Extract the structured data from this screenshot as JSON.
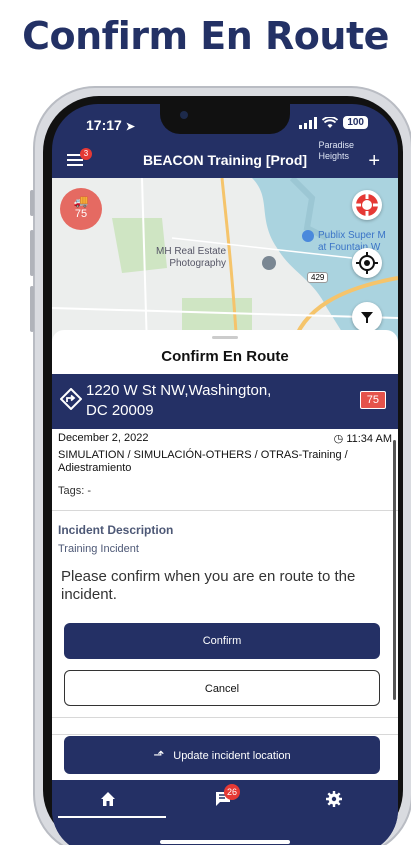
{
  "headline": "Confirm En Route",
  "status_bar": {
    "time": "17:17",
    "battery": "100"
  },
  "app_header": {
    "title": "BEACON Training [Prod]",
    "menu_badge": "3"
  },
  "map": {
    "vehicle_unit": "75",
    "labels": {
      "paradise": "Paradise",
      "heights": "Heights",
      "real_estate_1": "MH Real Estate",
      "real_estate_2": "Photography",
      "publix_1": "Publix Super M",
      "publix_2": "at Fountain W",
      "road": "429"
    }
  },
  "sheet": {
    "title": "Confirm En Route",
    "address_line1": "1220 W St NW,Washington,",
    "address_line2": "DC 20009",
    "priority": "75",
    "date": "December 2, 2022",
    "time": "11:34 AM",
    "incident_type": "SIMULATION / SIMULACIÓN-OTHERS / OTRAS-Training / Adiestramiento",
    "tags": "Tags: -",
    "description_title": "Incident Description",
    "description_text": "Training Incident",
    "prompt": "Please confirm when you are en route to the incident.",
    "confirm_label": "Confirm",
    "cancel_label": "Cancel",
    "update_location_label": "Update incident location"
  },
  "tabbar": {
    "chat_badge": "26"
  },
  "colors": {
    "navy": "#243065",
    "badge_red": "#e53935",
    "vehicle_red": "#e56a62"
  }
}
